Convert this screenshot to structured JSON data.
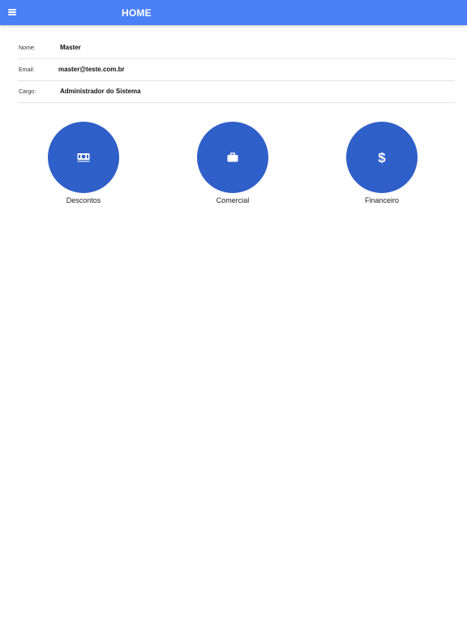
{
  "appbar": {
    "title": "HOME",
    "menu_icon": "menu-icon",
    "color": "#4a7ff5"
  },
  "user": {
    "rows": [
      {
        "label": "Nome:",
        "value": "Master"
      },
      {
        "label": "Email:",
        "value": "master@teste.com.br"
      },
      {
        "label": "Cargo:",
        "value": "Administrador do Sistema"
      }
    ]
  },
  "tiles": [
    {
      "label": "Descontos",
      "icon": "money-icon"
    },
    {
      "label": "Comercial",
      "icon": "briefcase-icon"
    },
    {
      "label": "Financeiro",
      "icon": "dollar-icon"
    }
  ],
  "colors": {
    "tile_bg": "#2f5fc8"
  }
}
